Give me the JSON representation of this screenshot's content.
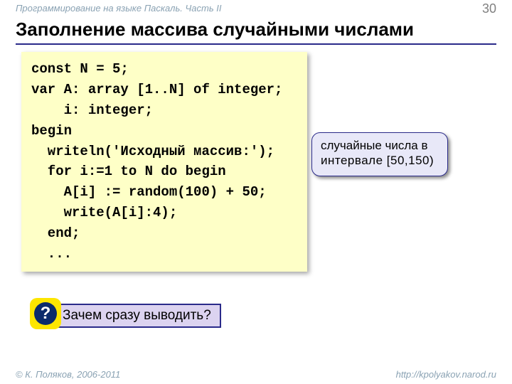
{
  "header": {
    "course_title": "Программирование на языке Паскаль. Часть II",
    "page_number": "30"
  },
  "title": "Заполнение массива случайными числами",
  "code": "const N = 5;\nvar A: array [1..N] of integer;\n    i: integer;\nbegin\n  writeln('Исходный массив:');\n  for i:=1 to N do begin\n    A[i] := random(100) + 50;\n    write(A[i]:4);\n  end;\n  ...",
  "callout": {
    "line1": "случайные числа в",
    "line2": "интервале [50,150)"
  },
  "question": {
    "mark": "?",
    "text": "Зачем сразу выводить?"
  },
  "footer": {
    "copyright": "© К. Поляков, 2006-2011",
    "url": "http://kpolyakov.narod.ru"
  }
}
